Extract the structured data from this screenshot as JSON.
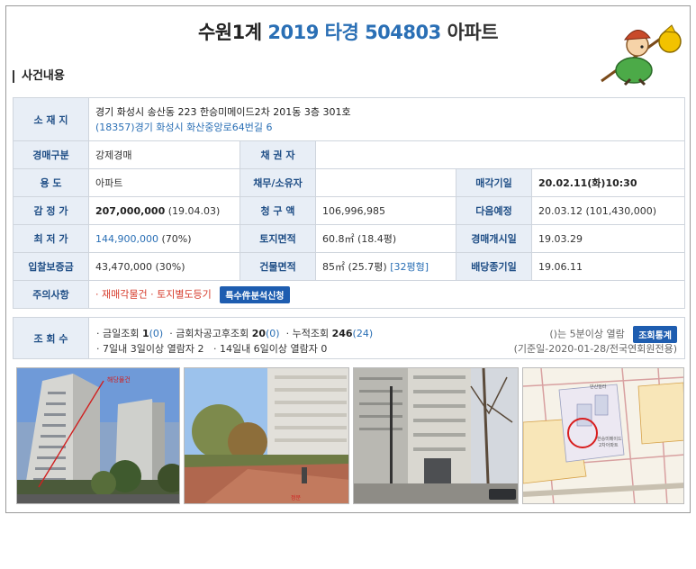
{
  "header": {
    "title_court": "수원1계",
    "title_case": "2019 타경 504803",
    "title_type": "아파트"
  },
  "section_title": "사건내용",
  "info": {
    "address_label": "소 재 지",
    "address_line1": "경기 화성시 송산동 223 한승미메이드2차 201동 3층 301호",
    "address_line2": "(18357)경기 화성시 화산중앙로64번길 6",
    "type_label": "경매구분",
    "type_value": "강제경매",
    "creditor_label": "채 권 자",
    "creditor_value": "",
    "use_label": "용 도",
    "use_value": "아파트",
    "debtor_label": "채무/소유자",
    "debtor_value": "",
    "sale_date_label": "매각기일",
    "sale_date_value": "20.02.11(화)10:30",
    "appraisal_label": "감 정 가",
    "appraisal_value": "207,000,000",
    "appraisal_note": "(19.04.03)",
    "claim_label": "청 구 액",
    "claim_value": "106,996,985",
    "next_label": "다음예정",
    "next_value": "20.03.12 (101,430,000)",
    "min_label": "최 저 가",
    "min_value": "144,900,000",
    "min_note": "(70%)",
    "land_label": "토지면적",
    "land_value": "60.8㎡ (18.4평)",
    "start_label": "경매개시일",
    "start_value": "19.03.29",
    "deposit_label": "입찰보증금",
    "deposit_value": "43,470,000 (30%)",
    "building_label": "건물면적",
    "building_value": "85㎡ (25.7평)",
    "building_link": "[32평형]",
    "dividend_label": "배당종기일",
    "dividend_value": "19.06.11",
    "notice_label": "주의사항",
    "notice_value": "· 재매각물건 · 토지별도등기",
    "notice_button": "특수件분석신청"
  },
  "views": {
    "label": "조 회 수",
    "today_label": "· 금일조회",
    "today_count": "1",
    "today_sub": "(0)",
    "after_label": "· 금회차공고후조회",
    "after_count": "20",
    "after_sub": "(0)",
    "total_label": "· 누적조회",
    "total_count": "246",
    "total_sub": "(24)",
    "week_text": "· 7일내 3일이상 열람자 2",
    "two_week_text": "· 14일내 6일이상 열람자 0",
    "note": "()는 5분이상 열람",
    "button": "조회통계",
    "basis": "(기준일-2020-01-28/전국연회원전용)"
  },
  "photos": {
    "photo1_caption": "해당물건",
    "photo2_caption": "정문",
    "map_labels": [
      "한승미메이드",
      "2차아파트",
      "안산빌라"
    ]
  }
}
